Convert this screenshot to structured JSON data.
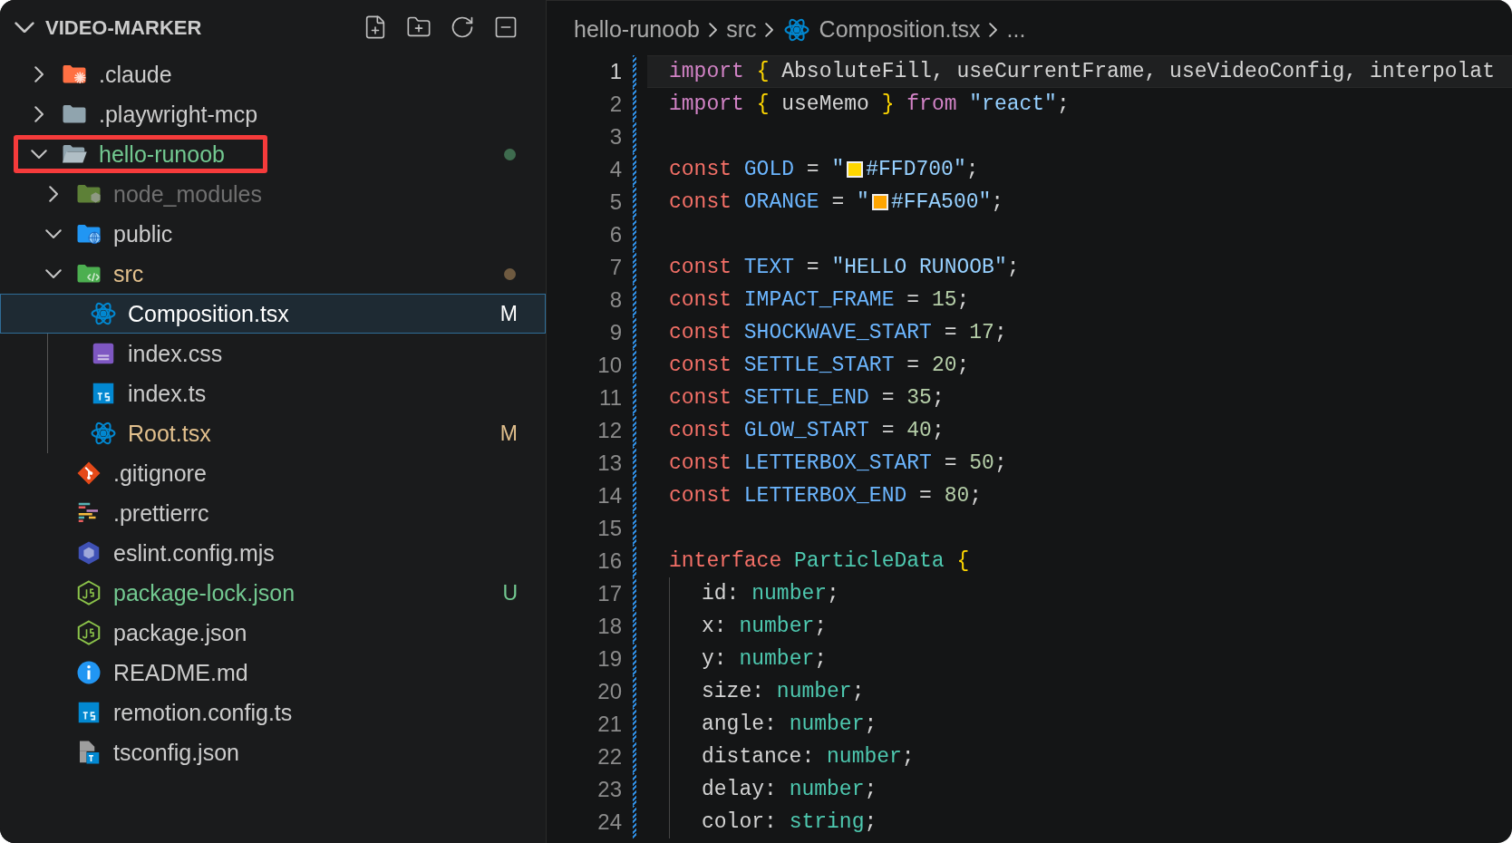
{
  "explorer": {
    "title": "VIDEO-MARKER",
    "items": [
      {
        "name": ".claude",
        "kind": "claude-folder",
        "expanded": false,
        "color": "#cccccc",
        "selected": false,
        "highlighted": false
      },
      {
        "name": ".playwright-mcp",
        "kind": "folder",
        "expanded": false,
        "color": "#cccccc",
        "selected": false,
        "highlighted": false
      },
      {
        "name": "hello-runoob",
        "kind": "open-folder",
        "expanded": true,
        "color": "#73c991",
        "decoration": {
          "kind": "dot",
          "color": "#3e6b4e"
        },
        "selected": false,
        "highlighted": true,
        "children": [
          {
            "name": "node_modules",
            "kind": "node-folder",
            "expanded": false,
            "color": "#707070",
            "selected": false,
            "highlighted": false
          },
          {
            "name": "public",
            "kind": "web-folder",
            "expanded": true,
            "color": "#cccccc",
            "selected": false,
            "highlighted": false
          },
          {
            "name": "src",
            "kind": "src-folder",
            "expanded": true,
            "color": "#e2c08d",
            "decoration": {
              "kind": "dot",
              "color": "#6e5a40"
            },
            "selected": false,
            "highlighted": false,
            "children": [
              {
                "name": "Composition.tsx",
                "kind": "react",
                "color": "#ffffff",
                "decoration": {
                  "kind": "letter",
                  "text": "M"
                },
                "selected": true,
                "highlighted": false
              },
              {
                "name": "index.css",
                "kind": "css",
                "color": "#cccccc",
                "selected": false,
                "highlighted": false
              },
              {
                "name": "index.ts",
                "kind": "ts",
                "color": "#cccccc",
                "selected": false,
                "highlighted": false
              },
              {
                "name": "Root.tsx",
                "kind": "react",
                "color": "#e2c08d",
                "decoration": {
                  "kind": "letter",
                  "text": "M"
                },
                "selected": false,
                "highlighted": false
              }
            ]
          },
          {
            "name": ".gitignore",
            "kind": "git",
            "color": "#cccccc",
            "selected": false,
            "highlighted": false
          },
          {
            "name": ".prettierrc",
            "kind": "prettier",
            "color": "#cccccc",
            "selected": false,
            "highlighted": false
          },
          {
            "name": "eslint.config.mjs",
            "kind": "eslint",
            "color": "#cccccc",
            "selected": false,
            "highlighted": false
          },
          {
            "name": "package-lock.json",
            "kind": "node-json",
            "color": "#73c991",
            "decoration": {
              "kind": "letter",
              "text": "U"
            },
            "selected": false,
            "highlighted": false
          },
          {
            "name": "package.json",
            "kind": "node-json",
            "color": "#cccccc",
            "selected": false,
            "highlighted": false
          },
          {
            "name": "README.md",
            "kind": "info",
            "color": "#cccccc",
            "selected": false,
            "highlighted": false
          },
          {
            "name": "remotion.config.ts",
            "kind": "ts",
            "color": "#cccccc",
            "selected": false,
            "highlighted": false
          },
          {
            "name": "tsconfig.json",
            "kind": "tsconfig",
            "color": "#cccccc",
            "selected": false,
            "highlighted": false
          }
        ]
      }
    ]
  },
  "breadcrumb": [
    {
      "text": "hello-runoob",
      "kind": "folder"
    },
    {
      "text": "src",
      "kind": "folder"
    },
    {
      "text": "Composition.tsx",
      "kind": "react"
    },
    {
      "text": "...",
      "kind": "more"
    }
  ],
  "editor": {
    "lines": [
      {
        "number": "1",
        "current": true,
        "tokens": [
          {
            "kind": "keyword",
            "text": "import"
          },
          {
            "kind": "brace",
            "text": " {"
          },
          {
            "kind": "plain",
            "text": " AbsoluteFill, useCurrentFrame, useVideoConfig, interpolat"
          }
        ]
      },
      {
        "number": "2",
        "current": false,
        "tokens": [
          {
            "kind": "keyword",
            "text": "import"
          },
          {
            "kind": "brace",
            "text": " {"
          },
          {
            "kind": "plain",
            "text": " useMemo "
          },
          {
            "kind": "brace",
            "text": "}"
          },
          {
            "kind": "keyword",
            "text": " from"
          },
          {
            "kind": "string",
            "text": " \"react\""
          },
          {
            "kind": "plain",
            "text": ";"
          }
        ]
      },
      {
        "number": "3",
        "current": false
      },
      {
        "number": "4",
        "current": false,
        "tokens": [
          {
            "kind": "storage",
            "text": "const"
          },
          {
            "kind": "constant",
            "text": " GOLD"
          },
          {
            "kind": "plain",
            "text": " = "
          },
          {
            "kind": "string",
            "text": "\""
          },
          {
            "kind": "swatch",
            "color": "#ffd700"
          },
          {
            "kind": "string",
            "text": "#FFD700\""
          },
          {
            "kind": "plain",
            "text": ";"
          }
        ]
      },
      {
        "number": "5",
        "current": false,
        "tokens": [
          {
            "kind": "storage",
            "text": "const"
          },
          {
            "kind": "constant",
            "text": " ORANGE"
          },
          {
            "kind": "plain",
            "text": " = "
          },
          {
            "kind": "string",
            "text": "\""
          },
          {
            "kind": "swatch",
            "color": "#ffa500"
          },
          {
            "kind": "string",
            "text": "#FFA500\""
          },
          {
            "kind": "plain",
            "text": ";"
          }
        ]
      },
      {
        "number": "6",
        "current": false
      },
      {
        "number": "7",
        "current": false,
        "tokens": [
          {
            "kind": "storage",
            "text": "const"
          },
          {
            "kind": "constant",
            "text": " TEXT"
          },
          {
            "kind": "plain",
            "text": " = "
          },
          {
            "kind": "string",
            "text": "\"HELLO RUNOOB\""
          },
          {
            "kind": "plain",
            "text": ";"
          }
        ]
      },
      {
        "number": "8",
        "current": false,
        "tokens": [
          {
            "kind": "storage",
            "text": "const"
          },
          {
            "kind": "constant",
            "text": " IMPACT_FRAME"
          },
          {
            "kind": "plain",
            "text": " = "
          },
          {
            "kind": "number",
            "text": "15"
          },
          {
            "kind": "plain",
            "text": ";"
          }
        ]
      },
      {
        "number": "9",
        "current": false,
        "tokens": [
          {
            "kind": "storage",
            "text": "const"
          },
          {
            "kind": "constant",
            "text": " SHOCKWAVE_START"
          },
          {
            "kind": "plain",
            "text": " = "
          },
          {
            "kind": "number",
            "text": "17"
          },
          {
            "kind": "plain",
            "text": ";"
          }
        ]
      },
      {
        "number": "10",
        "current": false,
        "tokens": [
          {
            "kind": "storage",
            "text": "const"
          },
          {
            "kind": "constant",
            "text": " SETTLE_START"
          },
          {
            "kind": "plain",
            "text": " = "
          },
          {
            "kind": "number",
            "text": "20"
          },
          {
            "kind": "plain",
            "text": ";"
          }
        ]
      },
      {
        "number": "11",
        "current": false,
        "tokens": [
          {
            "kind": "storage",
            "text": "const"
          },
          {
            "kind": "constant",
            "text": " SETTLE_END"
          },
          {
            "kind": "plain",
            "text": " = "
          },
          {
            "kind": "number",
            "text": "35"
          },
          {
            "kind": "plain",
            "text": ";"
          }
        ]
      },
      {
        "number": "12",
        "current": false,
        "tokens": [
          {
            "kind": "storage",
            "text": "const"
          },
          {
            "kind": "constant",
            "text": " GLOW_START"
          },
          {
            "kind": "plain",
            "text": " = "
          },
          {
            "kind": "number",
            "text": "40"
          },
          {
            "kind": "plain",
            "text": ";"
          }
        ]
      },
      {
        "number": "13",
        "current": false,
        "tokens": [
          {
            "kind": "storage",
            "text": "const"
          },
          {
            "kind": "constant",
            "text": " LETTERBOX_START"
          },
          {
            "kind": "plain",
            "text": " = "
          },
          {
            "kind": "number",
            "text": "50"
          },
          {
            "kind": "plain",
            "text": ";"
          }
        ]
      },
      {
        "number": "14",
        "current": false,
        "tokens": [
          {
            "kind": "storage",
            "text": "const"
          },
          {
            "kind": "constant",
            "text": " LETTERBOX_END"
          },
          {
            "kind": "plain",
            "text": " = "
          },
          {
            "kind": "number",
            "text": "80"
          },
          {
            "kind": "plain",
            "text": ";"
          }
        ]
      },
      {
        "number": "15",
        "current": false
      },
      {
        "number": "16",
        "current": false,
        "tokens": [
          {
            "kind": "storage",
            "text": "interface"
          },
          {
            "kind": "type",
            "text": " ParticleData"
          },
          {
            "kind": "brace",
            "text": " {"
          }
        ],
        "children": [
          {
            "number": "17",
            "current": false,
            "tokens": [
              {
                "kind": "plain",
                "text": "id: "
              },
              {
                "kind": "type",
                "text": "number"
              },
              {
                "kind": "plain",
                "text": ";"
              }
            ]
          },
          {
            "number": "18",
            "current": false,
            "tokens": [
              {
                "kind": "plain",
                "text": "x: "
              },
              {
                "kind": "type",
                "text": "number"
              },
              {
                "kind": "plain",
                "text": ";"
              }
            ]
          },
          {
            "number": "19",
            "current": false,
            "tokens": [
              {
                "kind": "plain",
                "text": "y: "
              },
              {
                "kind": "type",
                "text": "number"
              },
              {
                "kind": "plain",
                "text": ";"
              }
            ]
          },
          {
            "number": "20",
            "current": false,
            "tokens": [
              {
                "kind": "plain",
                "text": "size: "
              },
              {
                "kind": "type",
                "text": "number"
              },
              {
                "kind": "plain",
                "text": ";"
              }
            ]
          },
          {
            "number": "21",
            "current": false,
            "tokens": [
              {
                "kind": "plain",
                "text": "angle: "
              },
              {
                "kind": "type",
                "text": "number"
              },
              {
                "kind": "plain",
                "text": ";"
              }
            ]
          },
          {
            "number": "22",
            "current": false,
            "tokens": [
              {
                "kind": "plain",
                "text": "distance: "
              },
              {
                "kind": "type",
                "text": "number"
              },
              {
                "kind": "plain",
                "text": ";"
              }
            ]
          },
          {
            "number": "23",
            "current": false,
            "tokens": [
              {
                "kind": "plain",
                "text": "delay: "
              },
              {
                "kind": "type",
                "text": "number"
              },
              {
                "kind": "plain",
                "text": ";"
              }
            ]
          },
          {
            "number": "24",
            "current": false,
            "tokens": [
              {
                "kind": "plain",
                "text": "color: "
              },
              {
                "kind": "type",
                "text": "string"
              },
              {
                "kind": "plain",
                "text": ";"
              }
            ]
          }
        ]
      }
    ]
  }
}
